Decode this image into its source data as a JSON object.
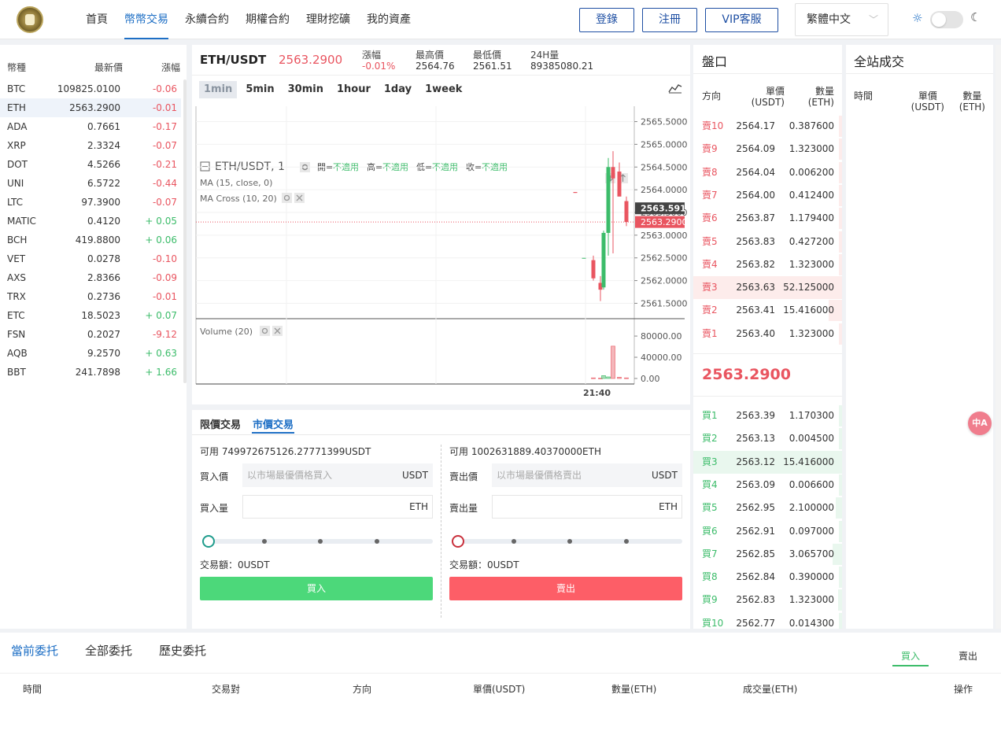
{
  "header": {
    "nav": [
      "首頁",
      "幣幣交易",
      "永續合約",
      "期權合約",
      "理財挖礦",
      "我的資產"
    ],
    "active_nav": 1,
    "login": "登錄",
    "register": "注冊",
    "vip": "VIP客服",
    "language": "繁體中文"
  },
  "market": {
    "headers": {
      "symbol": "幣種",
      "price": "最新價",
      "change": "漲幅"
    },
    "rows": [
      {
        "symbol": "BTC",
        "price": "109825.0100",
        "change": "-0.06"
      },
      {
        "symbol": "ETH",
        "price": "2563.2900",
        "change": "-0.01"
      },
      {
        "symbol": "ADA",
        "price": "0.7661",
        "change": "-0.17"
      },
      {
        "symbol": "XRP",
        "price": "2.3324",
        "change": "-0.07"
      },
      {
        "symbol": "DOT",
        "price": "4.5266",
        "change": "-0.21"
      },
      {
        "symbol": "UNI",
        "price": "6.5722",
        "change": "-0.44"
      },
      {
        "symbol": "LTC",
        "price": "97.3900",
        "change": "-0.07"
      },
      {
        "symbol": "MATIC",
        "price": "0.4120",
        "change": "+ 0.05"
      },
      {
        "symbol": "BCH",
        "price": "419.8800",
        "change": "+ 0.06"
      },
      {
        "symbol": "VET",
        "price": "0.0278",
        "change": "-0.10"
      },
      {
        "symbol": "AXS",
        "price": "2.8366",
        "change": "-0.09"
      },
      {
        "symbol": "TRX",
        "price": "0.2736",
        "change": "-0.01"
      },
      {
        "symbol": "ETC",
        "price": "18.5023",
        "change": "+ 0.07"
      },
      {
        "symbol": "FSN",
        "price": "0.2027",
        "change": "-9.12"
      },
      {
        "symbol": "AQB",
        "price": "9.2570",
        "change": "+ 0.63"
      },
      {
        "symbol": "BBT",
        "price": "241.7898",
        "change": "+ 1.66"
      }
    ]
  },
  "ticker": {
    "pair": "ETH/USDT",
    "price": "2563.2900",
    "change_label": "漲幅",
    "change_value": "-0.01%",
    "high_label": "最高價",
    "high_value": "2564.76",
    "low_label": "最低價",
    "low_value": "2561.51",
    "vol_label": "24H量",
    "vol_value": "89385080.21"
  },
  "intervals": [
    "1min",
    "5min",
    "30min",
    "1hour",
    "1day",
    "1week"
  ],
  "chart": {
    "legend_title": "ETH/USDT, 1",
    "ohlc": [
      {
        "label": "開=",
        "value": "不適用"
      },
      {
        "label": "高=",
        "value": "不適用"
      },
      {
        "label": "低=",
        "value": "不適用"
      },
      {
        "label": "收=",
        "value": "不適用"
      }
    ],
    "ma_label": "MA (15, close, 0)",
    "macross_label": "MA Cross (10, 20)",
    "volume_label": "Volume (20)",
    "price_ticks": [
      "2565.5000",
      "2565.0000",
      "2564.5000",
      "2564.0000",
      "2563.5000",
      "2563.0000",
      "2562.5000",
      "2562.0000",
      "2561.5000"
    ],
    "price_ticks_values": [
      2565.5,
      2565.0,
      2564.5,
      2564.0,
      2563.5,
      2563.0,
      2562.5,
      2562.0,
      2561.5
    ],
    "volume_ticks": [
      "80000.00",
      "40000.00",
      "0.00"
    ],
    "volume_ticks_values": [
      80000,
      40000,
      0
    ],
    "crosshair_label": "2563.5911",
    "crosshair_value": 2563.5911,
    "last_label": "2563.2900",
    "last_value": 2563.29,
    "time_label": "21:40",
    "colors": {
      "up": "#3cbc6a",
      "down": "#e95560"
    }
  },
  "chart_data": {
    "type": "candlestick",
    "title": "ETH/USDT, 1",
    "ylim": [
      2561.3,
      2565.7
    ],
    "volume_ylim": [
      0,
      92000
    ],
    "candles": [
      {
        "o": 2563.95,
        "h": 2563.95,
        "l": 2563.93,
        "c": 2563.93
      },
      {
        "o": 2562.5,
        "h": 2562.5,
        "l": 2562.5,
        "c": 2562.5
      },
      {
        "o": 2562.45,
        "h": 2562.55,
        "l": 2562.0,
        "c": 2562.05
      },
      {
        "o": 2561.95,
        "h": 2562.1,
        "l": 2561.55,
        "c": 2561.8
      },
      {
        "o": 2561.85,
        "h": 2563.1,
        "l": 2561.8,
        "c": 2563.05
      },
      {
        "o": 2563.05,
        "h": 2564.7,
        "l": 2562.55,
        "c": 2564.5
      },
      {
        "o": 2564.5,
        "h": 2564.85,
        "l": 2562.6,
        "c": 2564.25
      },
      {
        "o": 2564.4,
        "h": 2564.6,
        "l": 2564.1,
        "c": 2563.85
      },
      {
        "o": 2563.75,
        "h": 2563.85,
        "l": 2563.2,
        "c": 2563.29
      }
    ],
    "volumes": [
      0,
      0,
      1200,
      700,
      5500,
      3000,
      61000,
      2400,
      1200
    ]
  },
  "trade": {
    "tabs": [
      "限價交易",
      "市價交易"
    ],
    "active_tab": 1,
    "buy": {
      "available": "可用 749972675126.27771399USDT",
      "price_label": "買入價",
      "price_placeholder": "以市場最優價格買入",
      "price_unit": "USDT",
      "qty_label": "買入量",
      "qty_unit": "ETH",
      "amount": "交易額：0USDT",
      "button": "買入",
      "color": "#4cd87a"
    },
    "sell": {
      "available": "可用 1002631889.40370000ETH",
      "price_label": "賣出價",
      "price_placeholder": "以市場最優價格賣出",
      "price_unit": "USDT",
      "qty_label": "賣出量",
      "qty_unit": "ETH",
      "amount": "交易額：0USDT",
      "button": "賣出",
      "color": "#fd5e67"
    }
  },
  "book": {
    "title": "盤口",
    "headers": {
      "side": "方向",
      "price": "單價\n(USDT)",
      "qty": "數量\n(ETH)"
    },
    "mid_price": "2563.2900",
    "asks": [
      {
        "side": "賣10",
        "price": "2564.17",
        "qty": "0.387600",
        "depth": 0.0
      },
      {
        "side": "賣9",
        "price": "2564.09",
        "qty": "1.323000",
        "depth": 0.02
      },
      {
        "side": "賣8",
        "price": "2564.04",
        "qty": "0.006200",
        "depth": 0.0
      },
      {
        "side": "賣7",
        "price": "2564.00",
        "qty": "0.412400",
        "depth": 0.01
      },
      {
        "side": "賣6",
        "price": "2563.87",
        "qty": "1.179400",
        "depth": 0.02
      },
      {
        "side": "賣5",
        "price": "2563.83",
        "qty": "0.427200",
        "depth": 0.01
      },
      {
        "side": "賣4",
        "price": "2563.82",
        "qty": "1.323000",
        "depth": 0.02
      },
      {
        "side": "賣3",
        "price": "2563.63",
        "qty": "52.125000",
        "depth": 1.0
      },
      {
        "side": "賣2",
        "price": "2563.41",
        "qty": "15.416000",
        "depth": 0.29
      },
      {
        "side": "賣1",
        "price": "2563.40",
        "qty": "1.323000",
        "depth": 0.02
      }
    ],
    "bids": [
      {
        "side": "買1",
        "price": "2563.39",
        "qty": "1.170300",
        "depth": 0.07
      },
      {
        "side": "買2",
        "price": "2563.13",
        "qty": "0.004500",
        "depth": 0.0
      },
      {
        "side": "買3",
        "price": "2563.12",
        "qty": "15.416000",
        "depth": 1.0
      },
      {
        "side": "買4",
        "price": "2563.09",
        "qty": "0.006600",
        "depth": 0.0
      },
      {
        "side": "買5",
        "price": "2562.95",
        "qty": "2.100000",
        "depth": 0.14
      },
      {
        "side": "買6",
        "price": "2562.91",
        "qty": "0.097000",
        "depth": 0.01
      },
      {
        "side": "買7",
        "price": "2562.85",
        "qty": "3.065700",
        "depth": 0.2
      },
      {
        "side": "買8",
        "price": "2562.84",
        "qty": "0.390000",
        "depth": 0.03
      },
      {
        "side": "買9",
        "price": "2562.83",
        "qty": "1.323000",
        "depth": 0.09
      },
      {
        "side": "買10",
        "price": "2562.77",
        "qty": "0.014300",
        "depth": 0.0
      }
    ]
  },
  "trades": {
    "title": "全站成交",
    "headers": {
      "time": "時間",
      "price": "單價\n(USDT)",
      "qty": "數量\n(ETH)"
    }
  },
  "orders": {
    "tabs": [
      "當前委托",
      "全部委托",
      "歷史委托"
    ],
    "filters": [
      "買入",
      "賣出"
    ],
    "columns": [
      "時間",
      "交易對",
      "方向",
      "單價(USDT)",
      "數量(ETH)",
      "成交量(ETH)",
      "操作"
    ]
  },
  "translate_fab": "中A"
}
